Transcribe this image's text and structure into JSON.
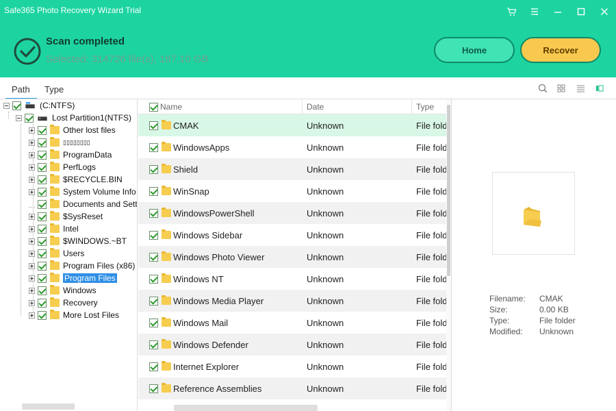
{
  "app": {
    "title": "Safe365 Photo Recovery Wizard Trial"
  },
  "window_controls": [
    "cart-icon",
    "menu-icon",
    "minimize-icon",
    "maximize-icon",
    "close-icon"
  ],
  "status": {
    "title": "Scan completed",
    "selected": "Selected: 314726 file(s), 187.10 GB"
  },
  "buttons": {
    "home": "Home",
    "recover": "Recover"
  },
  "tabs": {
    "path": "Path",
    "type": "Type"
  },
  "tree": {
    "root": "(C:NTFS)",
    "partition": "Lost Partition1(NTFS)",
    "items": [
      "Other lost files",
      "▯▯▯▯▯▯▯▯",
      "ProgramData",
      "PerfLogs",
      "$RECYCLE.BIN",
      "System Volume Info",
      "Documents and Sett",
      "$SysReset",
      "Intel",
      "$WINDOWS.~BT",
      "Users",
      "Program Files (x86)",
      "Program Files",
      "Windows",
      "Recovery",
      "More Lost Files"
    ]
  },
  "list": {
    "columns": {
      "name": "Name",
      "date": "Date",
      "type": "Type"
    },
    "rows": [
      {
        "name": "CMAK",
        "date": "Unknown",
        "type": "File folder"
      },
      {
        "name": "WindowsApps",
        "date": "Unknown",
        "type": "File folder"
      },
      {
        "name": "Shield",
        "date": "Unknown",
        "type": "File folder"
      },
      {
        "name": "WinSnap",
        "date": "Unknown",
        "type": "File folder"
      },
      {
        "name": "WindowsPowerShell",
        "date": "Unknown",
        "type": "File folder"
      },
      {
        "name": "Windows Sidebar",
        "date": "Unknown",
        "type": "File folder"
      },
      {
        "name": "Windows Photo Viewer",
        "date": "Unknown",
        "type": "File folder"
      },
      {
        "name": "Windows NT",
        "date": "Unknown",
        "type": "File folder"
      },
      {
        "name": "Windows Media Player",
        "date": "Unknown",
        "type": "File folder"
      },
      {
        "name": "Windows Mail",
        "date": "Unknown",
        "type": "File folder"
      },
      {
        "name": "Windows Defender",
        "date": "Unknown",
        "type": "File folder"
      },
      {
        "name": "Internet Explorer",
        "date": "Unknown",
        "type": "File folder"
      },
      {
        "name": "Reference Assemblies",
        "date": "Unknown",
        "type": "File folder"
      }
    ]
  },
  "preview": {
    "filename_label": "Filename:",
    "filename": "CMAK",
    "size_label": "Size:",
    "size": "0.00 KB",
    "type_label": "Type:",
    "type": "File folder",
    "modified_label": "Modified:",
    "modified": "Unknown"
  },
  "colors": {
    "header": "#1dd4a1",
    "home_button": "#3fe3b4",
    "recover_button": "#f9c94f",
    "selection": "#2f8fe6",
    "selected_row": "#d9f7e6"
  }
}
